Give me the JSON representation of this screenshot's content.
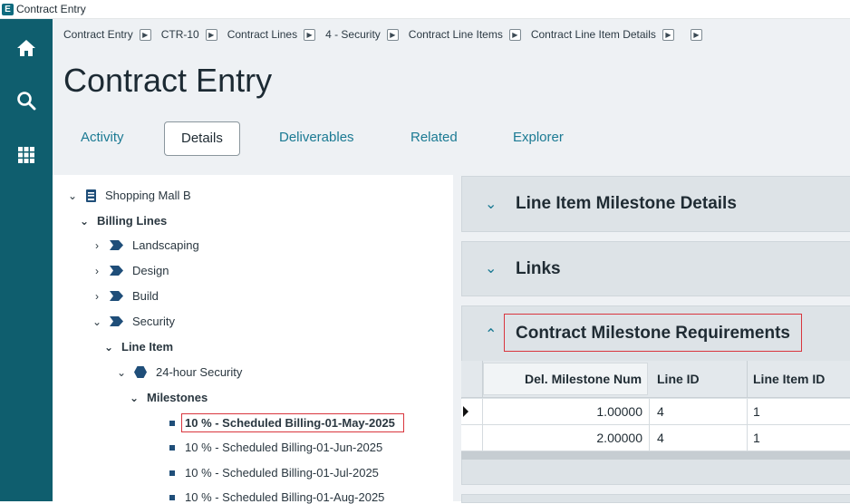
{
  "window": {
    "title": "Contract Entry"
  },
  "breadcrumb": [
    "Contract Entry",
    "CTR-10",
    "Contract Lines",
    "4 - Security",
    "Contract Line Items",
    "Contract Line Item Details",
    ""
  ],
  "page_title": "Contract Entry",
  "tabs": [
    {
      "label": "Activity",
      "active": false
    },
    {
      "label": "Details",
      "active": true
    },
    {
      "label": "Deliverables",
      "active": false
    },
    {
      "label": "Related",
      "active": false
    },
    {
      "label": "Explorer",
      "active": false
    }
  ],
  "tree": {
    "root": "Shopping Mall B",
    "billing_lines_label": "Billing Lines",
    "billing_lines": [
      "Landscaping",
      "Design",
      "Build",
      "Security"
    ],
    "line_item_label": "Line Item",
    "line_item": "24-hour Security",
    "milestones_label": "Milestones",
    "milestones": [
      "10 % - Scheduled Billing-01-May-2025",
      "10 % - Scheduled Billing-01-Jun-2025",
      "10 % - Scheduled Billing-01-Jul-2025",
      "10 % - Scheduled Billing-01-Aug-2025"
    ]
  },
  "panels": {
    "milestone_details": "Line Item Milestone Details",
    "links": "Links",
    "requirements": "Contract Milestone Requirements"
  },
  "grid": {
    "columns": [
      "Del. Milestone Num",
      "Line ID",
      "Line Item ID"
    ],
    "rows": [
      [
        "1.00000",
        "4",
        "1"
      ],
      [
        "2.00000",
        "4",
        "1"
      ]
    ]
  },
  "colors": {
    "nav": "#0f5e6e",
    "accent": "#1b7a93",
    "highlight": "#d9363e"
  }
}
